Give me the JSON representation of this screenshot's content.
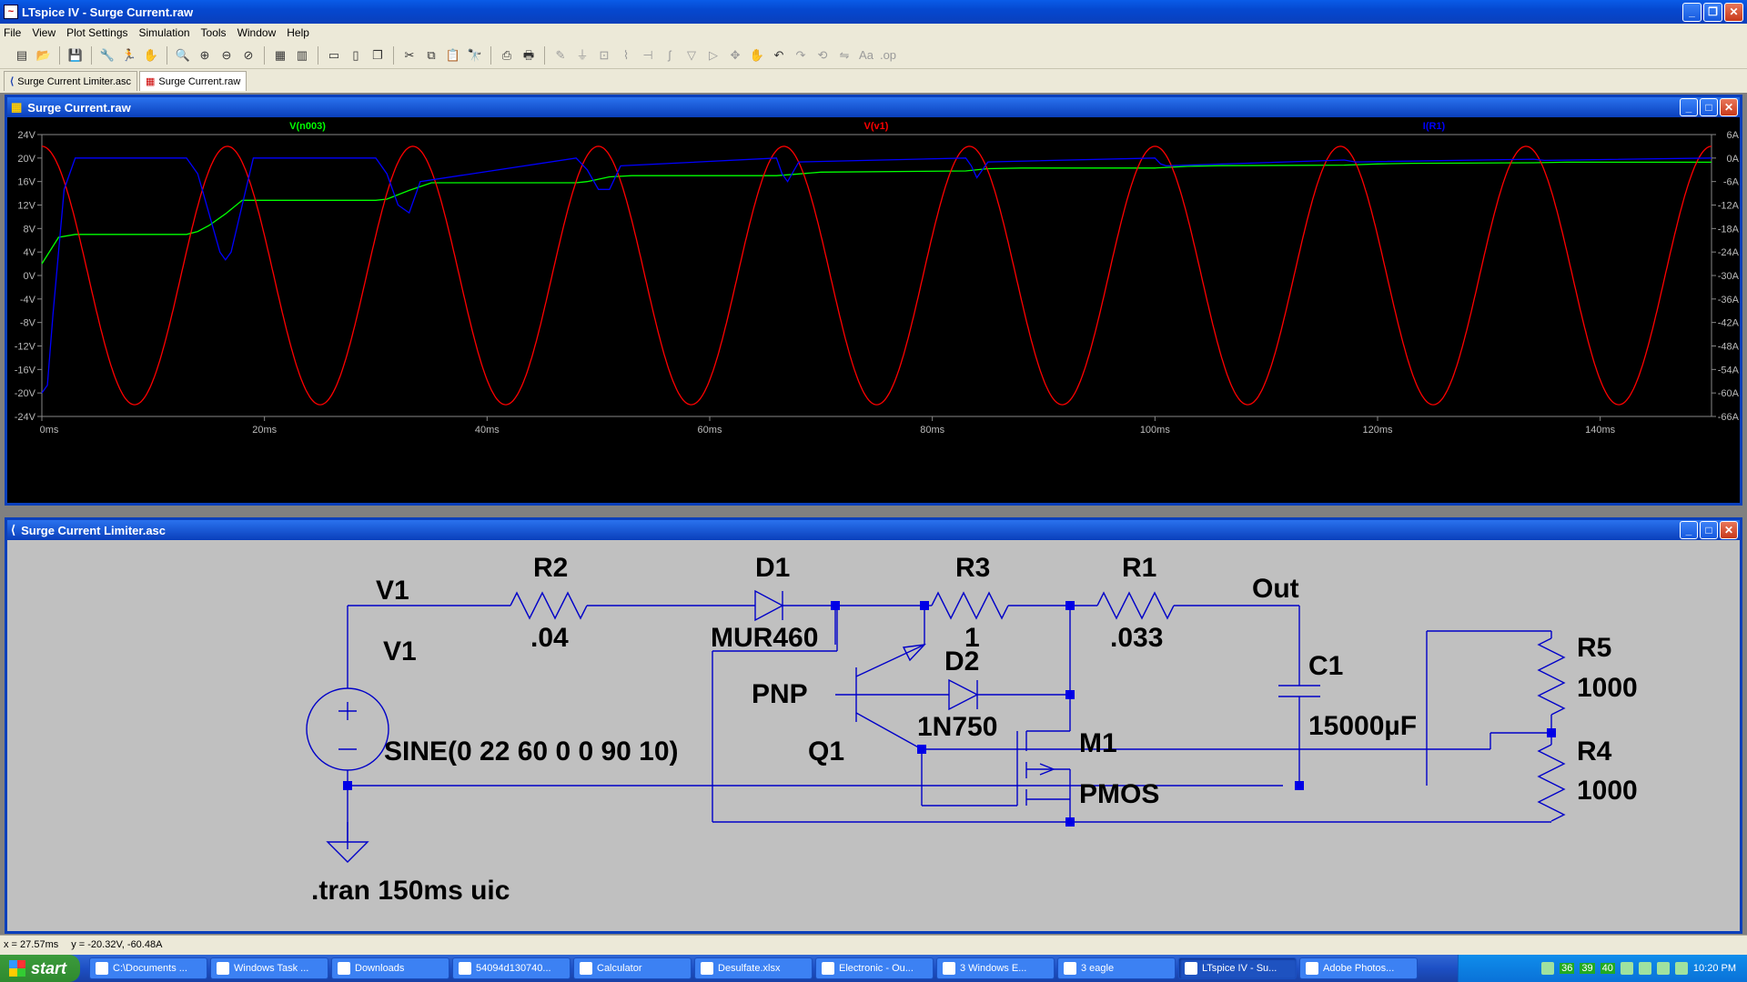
{
  "app": {
    "title": "LTspice IV - Surge Current.raw"
  },
  "menu": [
    "File",
    "View",
    "Plot Settings",
    "Simulation",
    "Tools",
    "Window",
    "Help"
  ],
  "tabs": [
    {
      "label": "Surge Current Limiter.asc"
    },
    {
      "label": "Surge Current.raw"
    }
  ],
  "plot_window": {
    "title": "Surge Current.raw"
  },
  "schematic_window": {
    "title": "Surge Current Limiter.asc"
  },
  "chart_data": {
    "type": "line",
    "x_ticks": [
      "0ms",
      "20ms",
      "40ms",
      "60ms",
      "80ms",
      "100ms",
      "120ms",
      "140ms"
    ],
    "x_range_ms": [
      0,
      150
    ],
    "y_left_ticks": [
      "24V",
      "20V",
      "16V",
      "12V",
      "8V",
      "4V",
      "0V",
      "-4V",
      "-8V",
      "-12V",
      "-16V",
      "-20V",
      "-24V"
    ],
    "y_left_range": [
      -24,
      24
    ],
    "y_right_ticks": [
      "6A",
      "0A",
      "-6A",
      "-12A",
      "-18A",
      "-24A",
      "-30A",
      "-36A",
      "-42A",
      "-48A",
      "-54A",
      "-60A",
      "-66A"
    ],
    "y_right_range": [
      -66,
      6
    ],
    "series": [
      {
        "name": "V(n003)",
        "color": "#00ff00",
        "axis": "left",
        "x": [
          0,
          1.5,
          3,
          13,
          14,
          15,
          16.5,
          18,
          30,
          31,
          33,
          35,
          48,
          49,
          51,
          53,
          66,
          68,
          70,
          83,
          85,
          88,
          100,
          103,
          106,
          117,
          120,
          123,
          134,
          137,
          140,
          150
        ],
        "y": [
          2,
          6.5,
          7,
          7,
          7.5,
          8.5,
          10.5,
          12.8,
          12.8,
          13,
          14.5,
          15.8,
          15.8,
          16,
          16.8,
          17,
          17,
          17.3,
          17.6,
          17.8,
          18.2,
          18.3,
          18.3,
          18.6,
          18.7,
          18.8,
          19,
          19.1,
          19.2,
          19.3,
          19.3,
          19.3
        ]
      },
      {
        "name": "V(v1)",
        "color": "#ff0000",
        "axis": "left",
        "amplitude": 22,
        "frequency_hz": 60,
        "formula": "22*sin(2*pi*60*t + pi/2)"
      },
      {
        "name": "I(R1)",
        "color": "#0000ff",
        "axis": "right",
        "x": [
          0,
          0.5,
          1,
          2,
          3,
          13,
          14,
          15,
          16,
          16.5,
          17,
          18,
          19,
          30,
          31,
          32,
          33,
          34,
          48,
          49,
          50,
          51,
          52,
          66,
          66.5,
          67,
          68,
          83,
          83.5,
          84,
          85,
          100,
          100.5,
          101,
          117,
          118,
          134,
          135,
          150
        ],
        "y": [
          -60,
          -58,
          -40,
          -8,
          0,
          0,
          -4,
          -14,
          -24,
          -26,
          -24,
          -12,
          0,
          0,
          -4,
          -12,
          -14,
          -6,
          0,
          -3,
          -8,
          -8,
          -2,
          0,
          -4,
          -6,
          -1,
          0,
          -2,
          -5,
          -1,
          0,
          -1.5,
          -2,
          -0.5,
          -1,
          -0.3,
          -0.6,
          0
        ]
      }
    ]
  },
  "schematic": {
    "labels": {
      "v1_net": "V1",
      "r2_name": "R2",
      "r2_value": ".04",
      "d1_name": "D1",
      "d1_value": "MUR460",
      "r3_name": "R3",
      "r3_value": "1",
      "r1_name": "R1",
      "r1_value": ".033",
      "out_net": "Out",
      "v1_name": "V1",
      "v1_value": "SINE(0 22 60 0 0 90 10)",
      "q1_type": "PNP",
      "q1_name": "Q1",
      "d2_name": "D2",
      "d2_value": "1N750",
      "m1_name": "M1",
      "m1_type": "PMOS",
      "c1_name": "C1",
      "c1_value": "15000µF",
      "r5_name": "R5",
      "r5_value": "1000",
      "r4_name": "R4",
      "r4_value": "1000",
      "directive": ".tran 150ms uic"
    }
  },
  "status": {
    "x": "x = 27.57ms",
    "y": "y = -20.32V, -60.48A"
  },
  "taskbar": {
    "start": "start",
    "items": [
      "C:\\Documents ...",
      "Windows Task ...",
      "Downloads",
      "54094d130740...",
      "Calculator",
      "Desulfate.xlsx",
      "Electronic - Ou...",
      "3 Windows E...",
      "3 eagle",
      "LTspice IV - Su...",
      "Adobe Photos..."
    ],
    "tray_numbers": [
      "36",
      "39",
      "40"
    ],
    "clock": "10:20 PM"
  }
}
